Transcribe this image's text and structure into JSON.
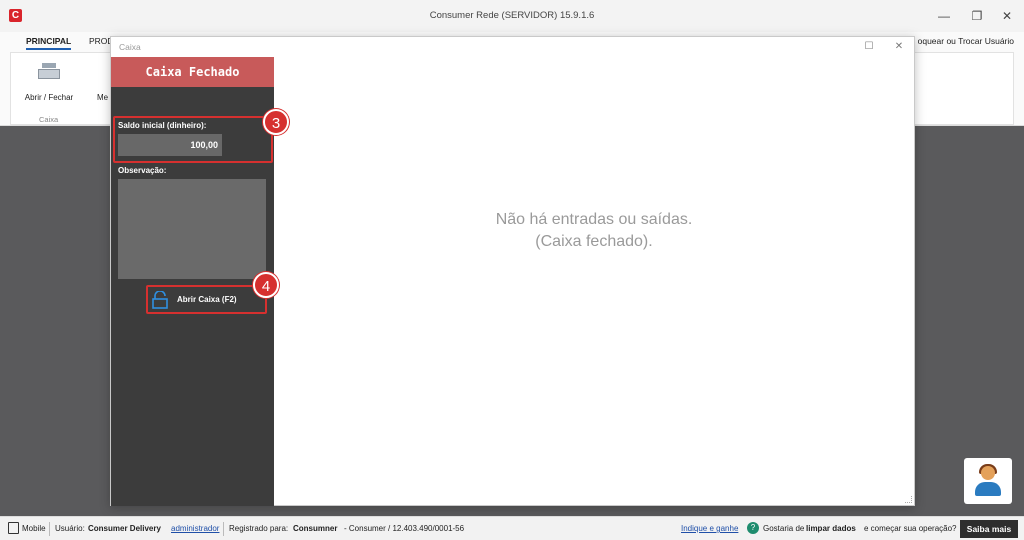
{
  "window": {
    "title": "Consumer Rede (SERVIDOR) 15.9.1.6",
    "controls": [
      "—",
      "❐",
      "✕"
    ]
  },
  "ribbon": {
    "tabs": [
      "PRINCIPAL",
      "PROD"
    ],
    "buttons": {
      "abrir_fechar": "Abrir / Fechar",
      "partial": "Me"
    },
    "group_label": "Caixa",
    "right_text": "oquear ou Trocar Usuário"
  },
  "dialog": {
    "title": "Caixa",
    "controls": [
      "☐",
      "✕"
    ],
    "header": "Caixa Fechado",
    "saldo_label": "Saldo inicial (dinheiro):",
    "saldo_value": "100,00",
    "obs_label": "Observação:",
    "abrir_button": "Abrir Caixa (F2)",
    "empty_line1": "Não há entradas ou saídas.",
    "empty_line2": "(Caixa fechado).",
    "badges": [
      "3",
      "4"
    ]
  },
  "status": {
    "mobile": "Mobile",
    "usuario_label": "Usuário:",
    "usuario_name": "Consumer Delivery",
    "usuario_role": "administrador",
    "registrado_label": "Registrado para:",
    "registrado_name": "Consumner",
    "registrado_rest": "- Consumer / 12.403.490/0001-56",
    "indique": "Indique e ganhe",
    "gostaria_pre": "Gostaria de",
    "gostaria_bold": "limpar dados",
    "gostaria_post": "e começar sua operação?",
    "saiba": "Saiba mais"
  },
  "colors": {
    "header_red": "#c85a5a",
    "highlight": "#d6302f",
    "sidebar": "#3c3c3c",
    "accent_blue": "#1f5fb0"
  }
}
